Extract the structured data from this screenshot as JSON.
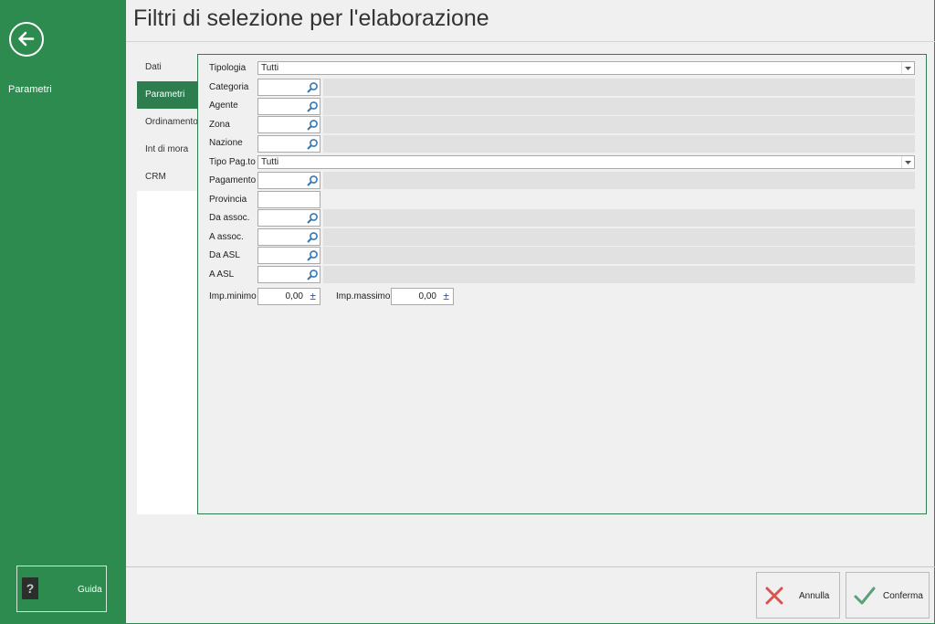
{
  "sidebar": {
    "section_label": "Parametri",
    "help_label": "Guida"
  },
  "header": {
    "title": "Filtri di selezione per l'elaborazione"
  },
  "tabs": [
    {
      "label": "Dati",
      "active": false
    },
    {
      "label": "Parametri",
      "active": true
    },
    {
      "label": "Ordinamento",
      "active": false
    },
    {
      "label": "Int di mora",
      "active": false
    },
    {
      "label": "CRM",
      "active": false
    }
  ],
  "filters": {
    "tipologia": {
      "label": "Tipologia",
      "value": "Tutti"
    },
    "categoria": {
      "label": "Categoria",
      "code": "",
      "description": ""
    },
    "agente": {
      "label": "Agente",
      "code": "",
      "description": ""
    },
    "zona": {
      "label": "Zona",
      "code": "",
      "description": ""
    },
    "nazione": {
      "label": "Nazione",
      "code": "",
      "description": ""
    },
    "tipo_pagto": {
      "label": "Tipo Pag.to",
      "value": "Tutti"
    },
    "pagamento": {
      "label": "Pagamento",
      "code": "",
      "description": ""
    },
    "provincia": {
      "label": "Provincia",
      "value": ""
    },
    "da_assoc": {
      "label": "Da assoc.",
      "code": "",
      "description": ""
    },
    "a_assoc": {
      "label": "A assoc.",
      "code": "",
      "description": ""
    },
    "da_asl": {
      "label": "Da ASL",
      "code": "",
      "description": ""
    },
    "a_asl": {
      "label": "A ASL",
      "code": "",
      "description": ""
    },
    "imp_minimo": {
      "label": "Imp.minimo",
      "value": "0,00",
      "stepper": "±"
    },
    "imp_massimo": {
      "label": "Imp.massimo",
      "value": "0,00",
      "stepper": "±"
    }
  },
  "footer": {
    "cancel_label": "Annulla",
    "confirm_label": "Conferma"
  },
  "colors": {
    "accent": "#2e8b50",
    "tab_active": "#2e7d4f",
    "cancel_icon": "#d9534f",
    "confirm_icon": "#5aa07a"
  }
}
